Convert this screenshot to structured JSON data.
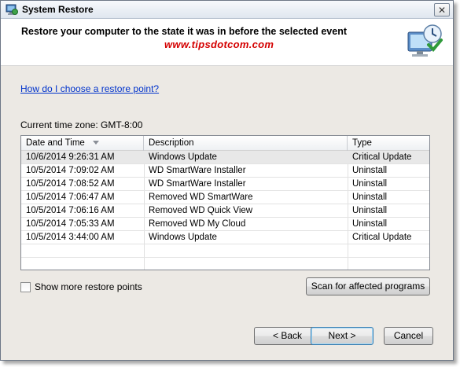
{
  "window": {
    "title": "System Restore",
    "close_glyph": "✕"
  },
  "header": {
    "title": "Restore your computer to the state it was in before the selected event",
    "watermark": "www.tipsdotcom.com",
    "icon": "system-restore-icon"
  },
  "help_link": "How do I choose a restore point?",
  "timezone_label": "Current time zone: GMT-8:00",
  "table": {
    "columns": [
      "Date and Time",
      "Description",
      "Type"
    ],
    "rows": [
      {
        "date": "10/6/2014 9:26:31 AM",
        "description": "Windows Update",
        "type": "Critical Update"
      },
      {
        "date": "10/5/2014 7:09:02 AM",
        "description": "WD SmartWare Installer",
        "type": "Uninstall"
      },
      {
        "date": "10/5/2014 7:08:52 AM",
        "description": "WD SmartWare Installer",
        "type": "Uninstall"
      },
      {
        "date": "10/5/2014 7:06:47 AM",
        "description": "Removed WD SmartWare",
        "type": "Uninstall"
      },
      {
        "date": "10/5/2014 7:06:16 AM",
        "description": "Removed WD Quick View",
        "type": "Uninstall"
      },
      {
        "date": "10/5/2014 7:05:33 AM",
        "description": "Removed WD My Cloud",
        "type": "Uninstall"
      },
      {
        "date": "10/5/2014 3:44:00 AM",
        "description": "Windows Update",
        "type": "Critical Update"
      }
    ],
    "selected_row": 0
  },
  "show_more_label": "Show more restore points",
  "buttons": {
    "scan": "Scan for affected programs",
    "back": "< Back",
    "next": "Next >",
    "cancel": "Cancel"
  },
  "colors": {
    "watermark": "#d40000",
    "link": "#0033cc",
    "dialog_bg": "#ece9e4"
  }
}
